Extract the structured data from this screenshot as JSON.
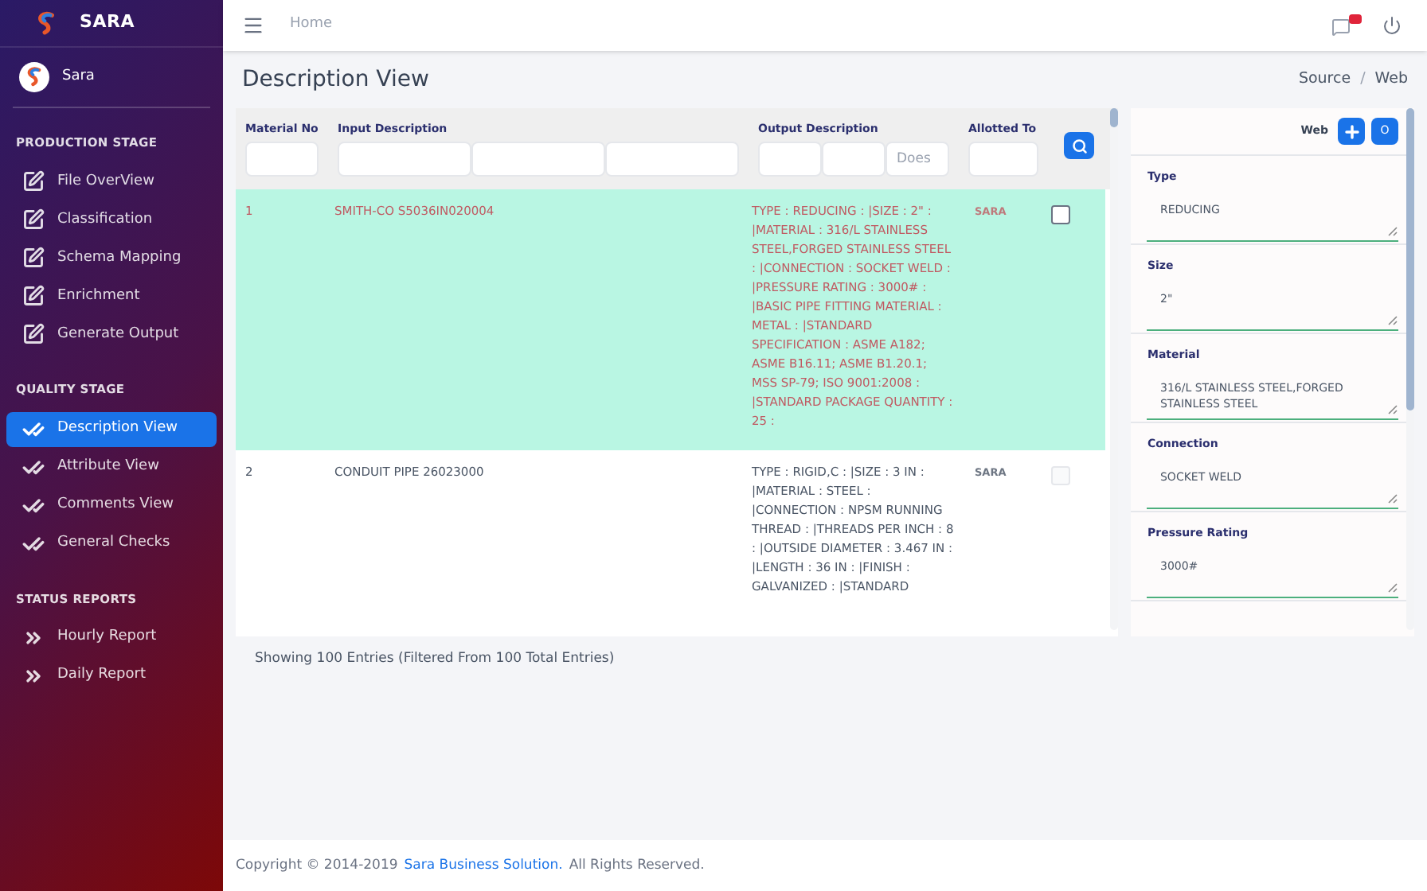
{
  "sidebar": {
    "brand": "SARA",
    "user": "Sara",
    "sections": [
      {
        "title": "PRODUCTION STAGE",
        "items": [
          {
            "label": "File OverView",
            "kind": "edit",
            "selected": false
          },
          {
            "label": "Classification",
            "kind": "edit",
            "selected": false
          },
          {
            "label": "Schema Mapping",
            "kind": "edit",
            "selected": false
          },
          {
            "label": "Enrichment",
            "kind": "edit",
            "selected": false
          },
          {
            "label": "Generate Output",
            "kind": "edit",
            "selected": false
          }
        ]
      },
      {
        "title": "QUALITY STAGE",
        "items": [
          {
            "label": "Description View",
            "kind": "check",
            "selected": true
          },
          {
            "label": "Attribute View",
            "kind": "check",
            "selected": false
          },
          {
            "label": "Comments View",
            "kind": "check",
            "selected": false
          },
          {
            "label": "General Checks",
            "kind": "check",
            "selected": false
          }
        ]
      },
      {
        "title": "STATUS REPORTS",
        "items": [
          {
            "label": "Hourly Report",
            "kind": "chevrons",
            "selected": false
          },
          {
            "label": "Daily Report",
            "kind": "chevrons",
            "selected": false
          }
        ]
      }
    ]
  },
  "topbar": {
    "breadcrumb": "Home"
  },
  "page": {
    "title": "Description View",
    "breadcrumb": [
      "Source",
      "Web"
    ],
    "breadcrumb_separator": "/"
  },
  "table": {
    "columns": [
      {
        "label": "Material No",
        "filters": [
          {
            "kind": "text"
          }
        ]
      },
      {
        "label": "Input Description",
        "filters": [
          {
            "kind": "text"
          },
          {
            "kind": "text"
          },
          {
            "kind": "text"
          }
        ]
      },
      {
        "label": "Output Description",
        "filters": [
          {
            "kind": "text"
          },
          {
            "kind": "text"
          },
          {
            "kind": "text",
            "placeholder": "Does"
          }
        ]
      },
      {
        "label": "Allotted To",
        "filters": [
          {
            "kind": "text"
          }
        ]
      }
    ],
    "rows": [
      {
        "number": "1",
        "input_description": "SMITH-CO S5036IN020004",
        "output_description": "TYPE : REDUCING : |SIZE : 2\" : |MATERIAL : 316/L STAINLESS STEEL,FORGED STAINLESS STEEL : |CONNECTION : SOCKET WELD : |PRESSURE RATING : 3000# : |BASIC PIPE FITTING MATERIAL : METAL : |STANDARD SPECIFICATION : ASME A182; ASME B16.11; ASME B1.20.1; MSS SP-79; ISO 9001:2008 : |STANDARD PACKAGE QUANTITY : 25 :",
        "allotted_to": "SARA",
        "selected": true,
        "checked": false,
        "disabled": false
      },
      {
        "number": "2",
        "input_description": "CONDUIT PIPE 26023000",
        "output_description": "TYPE : RIGID,C : |SIZE : 3 IN : |MATERIAL : STEEL : |CONNECTION : NPSM RUNNING THREAD : |THREADS PER INCH : 8 : |OUTSIDE DIAMETER : 3.467 IN : |LENGTH : 36 IN : |FINISH : GALVANIZED : |STANDARD",
        "allotted_to": "SARA",
        "selected": false,
        "checked": false,
        "disabled": true
      }
    ],
    "summary": "Showing 100 Entries (Filtered From 100 Total Entries)"
  },
  "attribute_panel": {
    "source": "Web",
    "extra_button": "O",
    "fields": [
      {
        "label": "Type",
        "value": "REDUCING"
      },
      {
        "label": "Size",
        "value": "2\""
      },
      {
        "label": "Material",
        "value": "316/L STAINLESS STEEL,FORGED STAINLESS STEEL"
      },
      {
        "label": "Connection",
        "value": "SOCKET WELD"
      },
      {
        "label": "Pressure Rating",
        "value": "3000#"
      }
    ]
  },
  "footer": {
    "copyright": "Copyright © 2014-2019",
    "company": "Sara Business Solution.",
    "rights": "All Rights Reserved."
  }
}
